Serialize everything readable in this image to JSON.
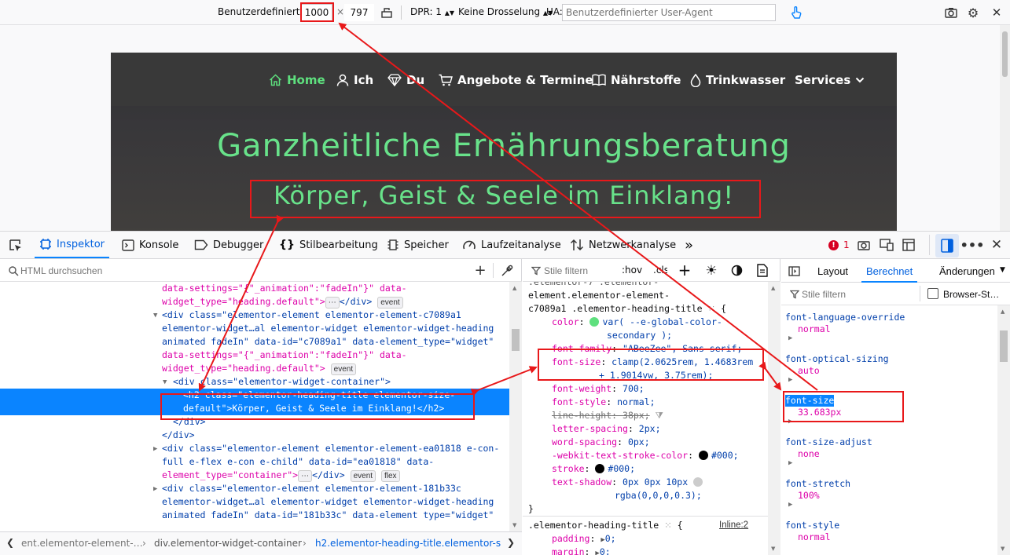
{
  "rdm": {
    "device": "Benutzerdefiniert",
    "width": "1000",
    "times": "×",
    "height": "797",
    "dpr": "DPR: 1",
    "throttling": "Keine Drosselung",
    "ua_label": "UA:",
    "ua_placeholder": "Benutzerdefinierter User-Agent"
  },
  "site": {
    "nav": [
      {
        "label": "Home",
        "icon": "home-icon"
      },
      {
        "label": "Ich",
        "icon": "user-icon"
      },
      {
        "label": "Du",
        "icon": "diamond-icon"
      },
      {
        "label": "Angebote & Termine",
        "icon": "cart-icon"
      },
      {
        "label": "Nährstoffe",
        "icon": "book-icon"
      },
      {
        "label": "Trinkwasser",
        "icon": "drop-icon"
      },
      {
        "label": "Services",
        "icon": "chevron-down-icon"
      }
    ],
    "title": "Ganzheitliche Ernährungsberatung",
    "subtitle": "Körper, Geist & Seele im Einklang!"
  },
  "devtools": {
    "tabs": [
      "Inspektor",
      "Konsole",
      "Debugger",
      "Stilbearbeitung",
      "Speicher",
      "Laufzeitanalyse",
      "Netzwerkanalyse"
    ],
    "more": "»",
    "error_count": "1",
    "search_placeholder": "HTML durchsuchen",
    "markup": {
      "l1": "data-settings=\"{\"_animation\":\"fadeIn\"}\" data-",
      "l2a": "widget_type=\"heading.default\">",
      "l2b": "</div>",
      "ellipsis": "⋯",
      "badge_event": "event",
      "badge_flex": "flex",
      "l3": "<div class=\"elementor-element elementor-element-c7089a1",
      "l4": "elementor-widget…al elementor-widget elementor-widget-heading",
      "l5": "animated fadeIn\" data-id=\"c7089a1\" data-element_type=\"widget\"",
      "l6": "data-settings=\"{\"_animation\":\"fadeIn\"}\" data-",
      "l7": "widget_type=\"heading.default\">",
      "l8": "<div class=\"elementor-widget-container\">",
      "l9": "<h2 class=\"elementor-heading-title elementor-size-",
      "l10": "default\">Körper, Geist & Seele im Einklang!</h2>",
      "l11": "</div>",
      "l12": "</div>",
      "l13": "<div class=\"elementor-element elementor-element-ea01818 e-con-",
      "l14": "full e-flex e-con e-child\" data-id=\"ea01818\" data-",
      "l15": "element_type=\"container\">",
      "l16": "</div>",
      "l17": "<div class=\"elementor-element elementor-element-181b33c",
      "l18": "elementor-widget…al elementor-widget elementor-widget-heading",
      "l19": "animated fadeIn\" data-id=\"181b33c\" data-element type=\"widget\""
    },
    "breadcrumbs": [
      "ent.elementor-element-…",
      "div.elementor-widget-container",
      "h2.elementor-heading-title.elementor-siz"
    ],
    "rules": {
      "filter_placeholder": "Stile filtern",
      "hov": ":hov",
      "cls": ".cls",
      "sel1": "element.elementor-element-",
      "sel2": "c7089a1 .elementor-heading-title",
      "brace_open": "{",
      "props": [
        {
          "name": "color",
          "value": "var( --e-global-color-",
          "value2": "secondary );",
          "swatch": "#5ee07e"
        },
        {
          "name": "font-family",
          "value": "\"ABeeZee\", Sans-serif;"
        },
        {
          "name": "font-size",
          "value": "clamp(2.0625rem, 1.4683rem",
          "value2": "+ 1.9014vw, 3.75rem);"
        },
        {
          "name": "font-weight",
          "value": "700;"
        },
        {
          "name": "font-style",
          "value": "normal;"
        },
        {
          "name": "line-height",
          "value": "38px;",
          "struck": true
        },
        {
          "name": "letter-spacing",
          "value": "2px;"
        },
        {
          "name": "word-spacing",
          "value": "0px;"
        },
        {
          "name": "-webkit-text-stroke-color",
          "value": "#000;",
          "swatch": "#000000"
        },
        {
          "name": "stroke",
          "value": "#000;",
          "swatch": "#000000"
        },
        {
          "name": "text-shadow",
          "value": "0px 0px 10px",
          "value2": "rgba(0,0,0,0.3);",
          "swatch": "#cccccc"
        }
      ],
      "brace_close": "}",
      "rule2_selector": ".elementor-heading-title",
      "rule2_source": "Inline:2",
      "rule2_props": [
        {
          "name": "padding",
          "value": "0;"
        },
        {
          "name": "margin",
          "value": "0;"
        }
      ]
    },
    "computed": {
      "tabs": [
        "Layout",
        "Berechnet",
        "Änderungen"
      ],
      "filter_placeholder": "Stile filtern",
      "browser_styles": "Browser-St…",
      "props": [
        {
          "name": "font-language-override",
          "value": "normal"
        },
        {
          "name": "font-optical-sizing",
          "value": "auto"
        },
        {
          "name": "font-size",
          "value": "33.683px"
        },
        {
          "name": "font-size-adjust",
          "value": "none"
        },
        {
          "name": "font-stretch",
          "value": "100%"
        },
        {
          "name": "font-style",
          "value": "normal"
        }
      ]
    }
  },
  "colors": {
    "accent": "#0a84ff",
    "site_green": "#68e28a",
    "annotation_red": "#e8181a"
  }
}
